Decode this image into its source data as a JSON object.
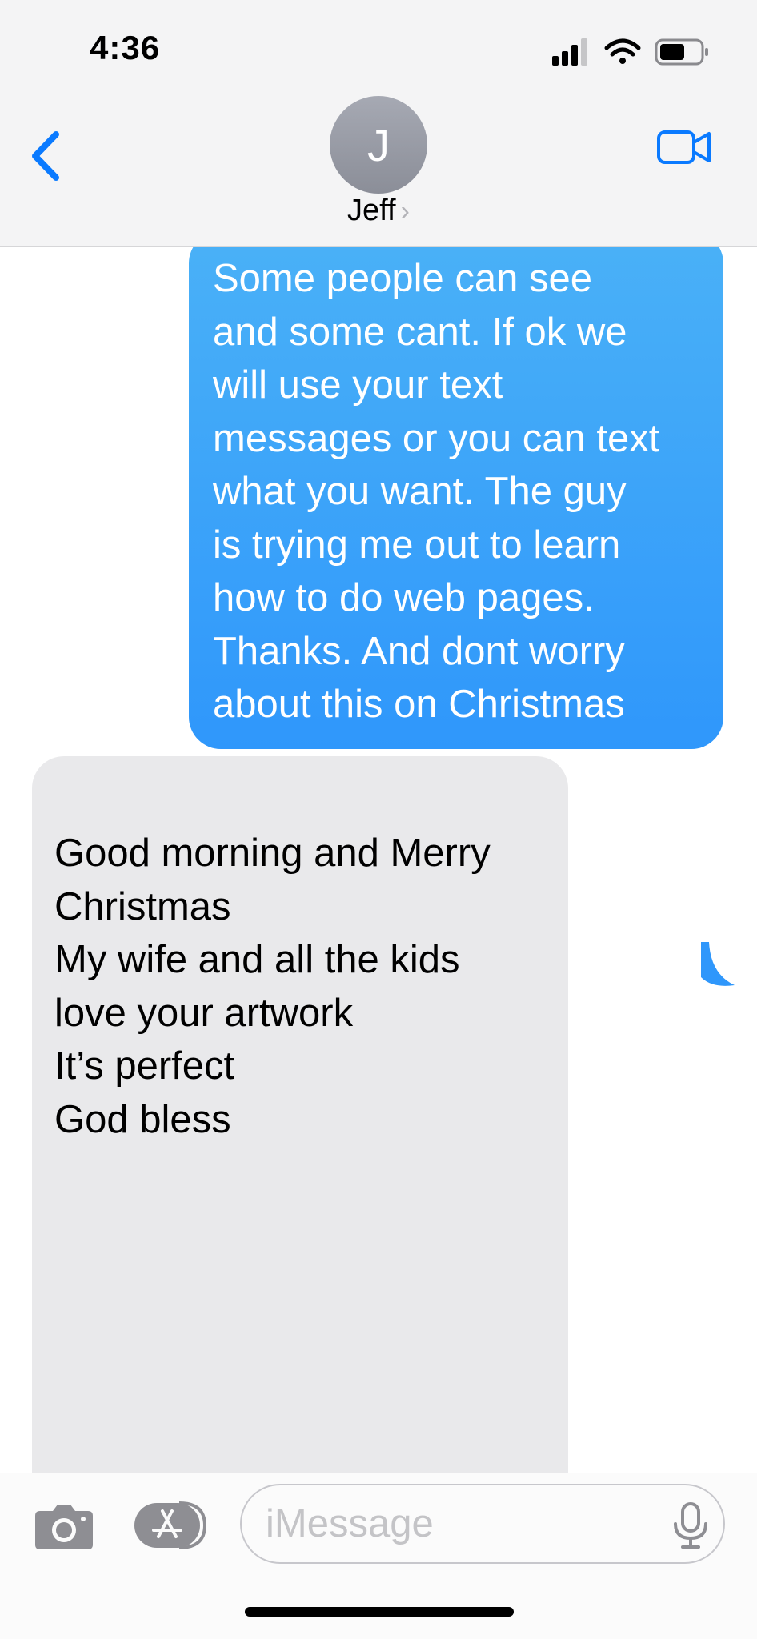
{
  "status_bar": {
    "time": "4:36"
  },
  "header": {
    "avatar_initial": "J",
    "contact_name": "Jeff",
    "chevron": "›"
  },
  "messages": [
    {
      "direction": "outgoing",
      "lines": [
        "Some people can see",
        "and some cant. If ok we",
        "will use your text",
        "messages or you can text",
        "what you want. The guy",
        "is trying me out to learn",
        "how to do web pages.",
        "Thanks. And dont worry",
        "about this on Christmas"
      ]
    },
    {
      "direction": "incoming",
      "lines": [
        "Good morning and Merry",
        "Christmas",
        "My wife and all the kids",
        "love your artwork",
        "It’s perfect",
        "God bless"
      ]
    }
  ],
  "composer": {
    "placeholder": "iMessage"
  },
  "icons": [
    "signal-icon",
    "wifi-icon",
    "battery-icon",
    "back-chevron-icon",
    "video-camera-icon",
    "camera-icon",
    "app-store-icon",
    "microphone-icon"
  ],
  "colors": {
    "accent": "#0a7aff",
    "outgoing_bubble": "#3aa2f8",
    "incoming_bubble": "#e9e9eb"
  }
}
